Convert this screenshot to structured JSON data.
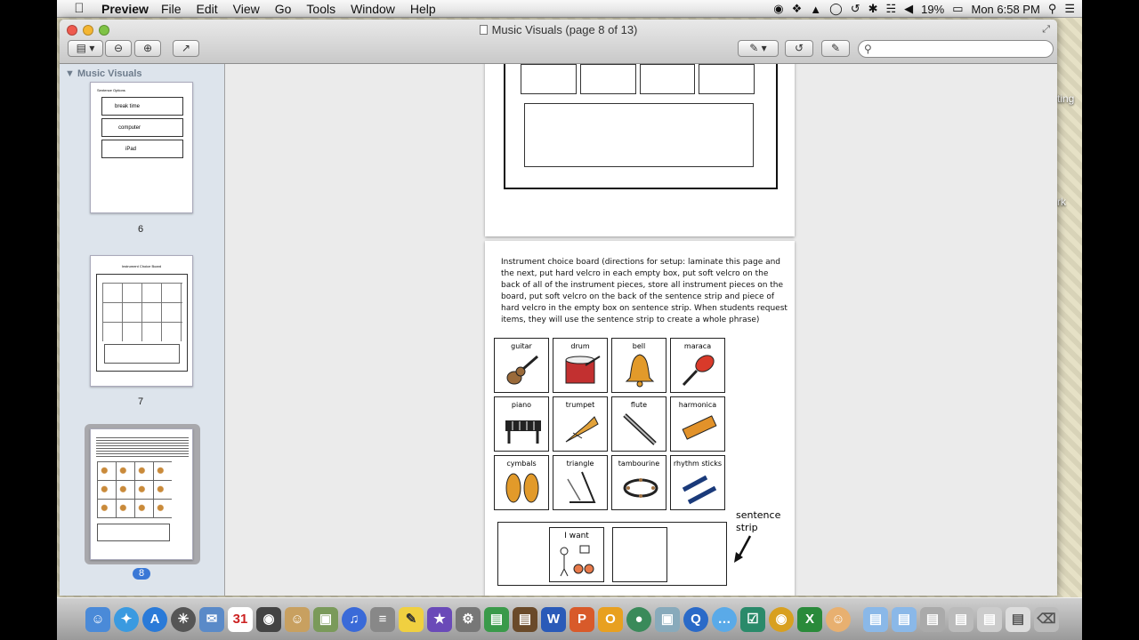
{
  "menubar": {
    "app_name": "Preview",
    "menus": [
      "File",
      "Edit",
      "View",
      "Go",
      "Tools",
      "Window",
      "Help"
    ],
    "battery": "19%",
    "clock": "Mon 6:58 PM"
  },
  "window": {
    "title": "Music Visuals (page 8 of 13)",
    "search_placeholder": ""
  },
  "sidebar": {
    "header": "Music Visuals",
    "page_numbers": [
      "6",
      "7",
      "8"
    ],
    "thumb6_heading": "Sentence Options",
    "thumb6_items": [
      "break time",
      "computer",
      "iPad"
    ],
    "thumb7_heading": "Instrument Choice Board"
  },
  "page8": {
    "directions": "Instrument choice board (directions for setup: laminate this page and the next, put hard velcro in each empty box, put soft velcro on the back of all of the instrument pieces, store all instrument pieces on the board, put soft velcro on the back of the sentence strip and piece of hard velcro in the empty box on sentence strip. When students request items, they will use the sentence strip to create a whole phrase)",
    "instruments": [
      "guitar",
      "drum",
      "bell",
      "maraca",
      "piano",
      "trumpet",
      "flute",
      "harmonica",
      "cymbals",
      "triangle",
      "tambourine",
      "rhythm sticks"
    ],
    "i_want": "I want",
    "sentence_strip_note": "sentence strip"
  },
  "desktop": {
    "label1": "ting",
    "label2": "rk"
  }
}
